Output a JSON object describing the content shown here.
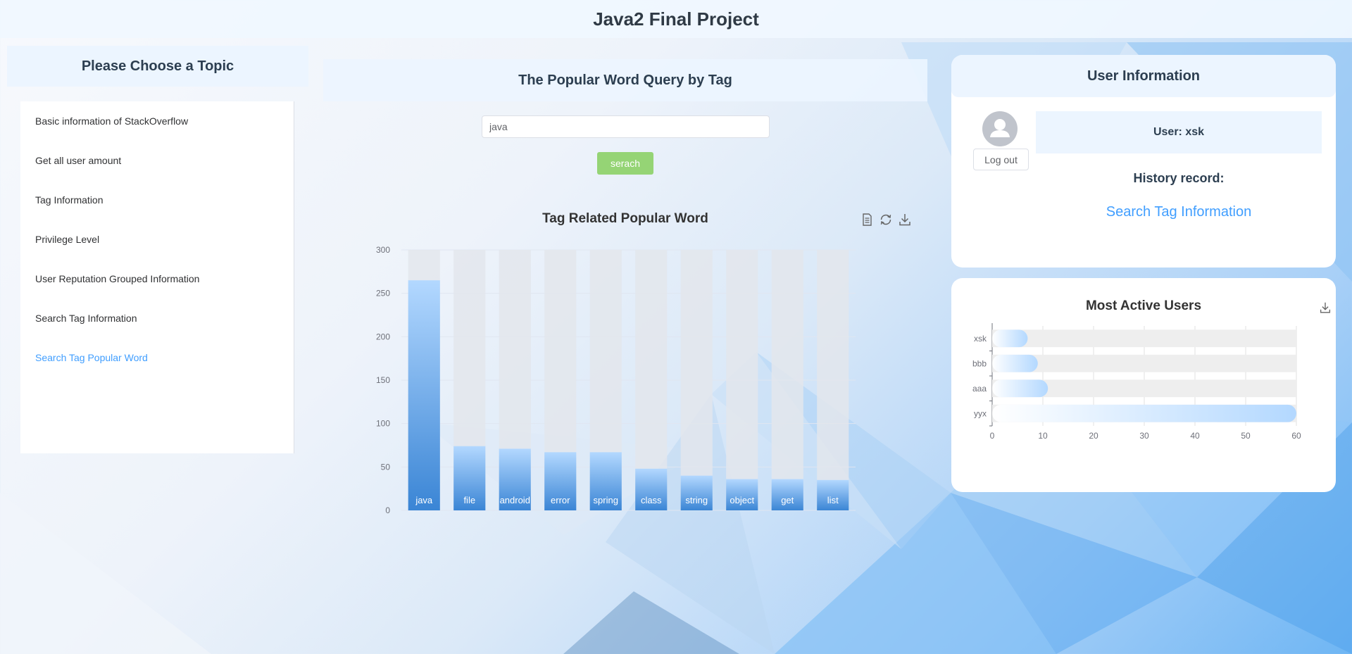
{
  "app": {
    "title": "Java2 Final Project"
  },
  "sidebar": {
    "title": "Please Choose a Topic",
    "items": [
      {
        "label": "Basic information of StackOverflow",
        "active": false
      },
      {
        "label": "Get all user amount",
        "active": false
      },
      {
        "label": "Tag Information",
        "active": false
      },
      {
        "label": "Privilege Level",
        "active": false
      },
      {
        "label": "User Reputation Grouped Information",
        "active": false
      },
      {
        "label": "Search Tag Information",
        "active": false
      },
      {
        "label": "Search Tag Popular Word",
        "active": true
      }
    ]
  },
  "main": {
    "title": "The Popular Word Query by Tag",
    "search": {
      "value": "java",
      "button_label": "serach"
    },
    "toolbox": [
      "data-view-icon",
      "restore-icon",
      "save-image-icon"
    ]
  },
  "user_panel": {
    "title": "User Information",
    "user_label": "User: xsk",
    "logout_label": "Log out",
    "history_label": "History record:",
    "history_items": [
      "Search Tag Information"
    ]
  },
  "active_users": {
    "toolbox": [
      "save-image-icon"
    ]
  },
  "colors": {
    "accent": "#409eff",
    "button_green": "#95d475",
    "panel_blue": "#ecf5ff",
    "bar_top": "#b3d8ff",
    "bar_bottom": "#3a85d5",
    "bar_track": "#e3e6ec"
  },
  "chart_data": [
    {
      "type": "bar",
      "title": "Tag Related Popular Word",
      "categories": [
        "java",
        "file",
        "android",
        "error",
        "spring",
        "class",
        "string",
        "object",
        "get",
        "list"
      ],
      "values": [
        265,
        74,
        71,
        67,
        67,
        48,
        40,
        36,
        36,
        35
      ],
      "ylim": [
        0,
        300
      ],
      "yticks": [
        0,
        50,
        100,
        150,
        200,
        250,
        300
      ],
      "grid": true,
      "background_bars": true,
      "labels_inside_bottom": true
    },
    {
      "type": "bar",
      "orientation": "horizontal",
      "title": "Most Active Users",
      "categories": [
        "yyx",
        "aaa",
        "bbb",
        "xsk"
      ],
      "values": [
        60,
        11,
        9,
        7
      ],
      "xlim": [
        0,
        60
      ],
      "xticks": [
        0,
        10,
        20,
        30,
        40,
        50,
        60
      ],
      "grid": true,
      "background_bars": true
    }
  ]
}
